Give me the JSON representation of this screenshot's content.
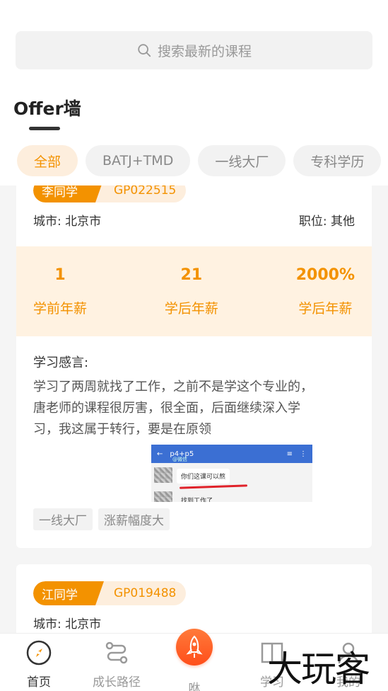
{
  "search": {
    "placeholder": "搜索最新的课程"
  },
  "page": {
    "title": "Offer墙"
  },
  "filters": [
    "全部",
    "BATJ+TMD",
    "一线大厂",
    "专科学历"
  ],
  "cards": [
    {
      "name": "李同学",
      "code": "GP022515",
      "city": "城市: 北京市",
      "position": "职位: 其他",
      "stats": [
        {
          "value": "1",
          "label": "学前年薪"
        },
        {
          "value": "21",
          "label": "学后年薪"
        },
        {
          "value": "2000%",
          "label": "学后年薪"
        }
      ],
      "impression_title": "学习感言:",
      "impression_text": "学习了两周就找了工作，之前不是学这个专业的，唐老师的课程很厉害，很全面，后面继续深入学习，我这属于转行，要是在原领",
      "screenshot": {
        "title": "p4+p5",
        "subtitle": "@微信",
        "msg1": "你们这课可以熬",
        "msg2": "找到工作了"
      },
      "tags": [
        "一线大厂",
        "涨薪幅度大"
      ]
    },
    {
      "name": "江同学",
      "code": "GP019488",
      "city": "城市: 北京市"
    }
  ],
  "tabbar": {
    "home": "首页",
    "path": "成长路径",
    "center": "咻",
    "study": "学习",
    "mine": "我的"
  },
  "watermark": "大玩客",
  "colors": {
    "accent": "#f39200",
    "center_button": "#ff5a1f"
  }
}
